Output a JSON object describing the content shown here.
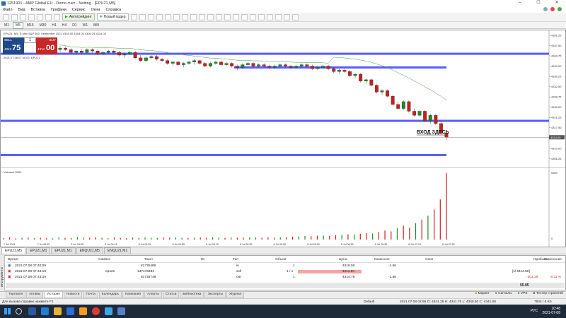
{
  "window": {
    "title": "1251901 - AMP Global EU - Demo счет - Netting - [EPU21,M5]",
    "controls": [
      "–",
      "☐",
      "✕"
    ]
  },
  "menu": [
    "Файл",
    "Вид",
    "Вставка",
    "Графики",
    "Сервис",
    "Окна",
    "Справка"
  ],
  "toolbar": {
    "autotrade": "Автотрейдинг",
    "new_order": "Новый ордер"
  },
  "timeframes": [
    "M1",
    "M5",
    "M15",
    "M30",
    "H1",
    "H4",
    "D1",
    "W1",
    "MN"
  ],
  "active_timeframe": "M5",
  "chart": {
    "header": "EPU21, M5: E-Mini S&P 500: September 2021  4318.00 4318.25 4300.25 4314.00",
    "symbol_info": "2021.07.08 07:40:00, EPU21",
    "sell_label": "SELL",
    "buy_label": "BUY",
    "lot": "1",
    "sell_price_small": "4313",
    "sell_price_big": "75",
    "buy_price_small": "4314",
    "buy_price_big": "00",
    "annotation": "ВХОД ЗДЕСЬ",
    "volume_label": "Volumes 5300",
    "volume_axis_max": "5300",
    "volume_axis_min": "0",
    "current_price_label": "4314.00",
    "price_ticks": [
      "4351.25",
      "4347.50",
      "4343.75",
      "4340.00",
      "4336.25",
      "4332.50",
      "4328.75",
      "4325.00",
      "4321.25",
      "4317.50",
      "4313.75",
      "4310.00",
      "4306.25"
    ],
    "time_ticks": [
      "7 Jul 2021",
      "7 Jul 06:55",
      "8 Jul 04:55",
      "8 Jul 04:15",
      "8 Jul 04:35",
      "8 Jul 04:55",
      "8 Jul 05:15",
      "8 Jul 05:35",
      "8 Jul 05:55",
      "8 Jul 06:15",
      "8 Jul 06:35",
      "8 Jul 06:55",
      "8 Jul 07:15",
      "8 Jul 07:35"
    ],
    "bull_color": "#1f8a1f",
    "bear_color": "#c81e1e",
    "level_color": "#5a5aff"
  },
  "chart_tabs": [
    "EPU21,M5",
    "EPU21,M1",
    "EPU21,M1",
    "ENQU21,M5",
    "ENQU21,M1"
  ],
  "terminal": {
    "columns": [
      "Время",
      "Символ",
      "Тикет",
      "ID",
      "Тип",
      "Объем",
      "Цена",
      "Комиссия",
      "Своп",
      "Прибыль",
      "Изменение"
    ],
    "rows": [
      {
        "time": "2021.07.08 07:40:09",
        "symbol": "",
        "ticket": "81735489",
        "type": "in",
        "volume": "1",
        "price": "4318.50",
        "commission": "-1.56",
        "swap": "",
        "profit": "",
        "change": ""
      },
      {
        "time": "2021.07.08 07:43:19",
        "symbol": "epu21",
        "ticket": "137178483",
        "type": "sell",
        "volume": "1 / 1",
        "price": "4314.50",
        "commission": "",
        "swap": "",
        "profit": "[sl 4314.50]",
        "change": ""
      },
      {
        "time": "2021.07.08 07:43:19",
        "symbol": "",
        "ticket": "81735748",
        "type": "out",
        "volume": "1",
        "price": "4314.75",
        "commission": "-1.56",
        "swap": "",
        "profit": "-201.19",
        "change": "-0.11 %"
      }
    ],
    "balance": "55.95",
    "side_label": "Инструменты"
  },
  "bottom_tabs": [
    "Торговля",
    "Активы",
    "История",
    "Новости",
    "Почта",
    "Календарь",
    "Компания",
    "Алерты",
    "Статьи",
    "Библиотека",
    "Эксперты",
    "Журнал"
  ],
  "active_bottom_tab": "История",
  "bottom_right": [
    "Маркет",
    "Сигналы",
    "VPS",
    "Тестер стратегий"
  ],
  "status": {
    "help": "Для вызова справки нажмите F1",
    "profile": "Default",
    "ohlc": "2021.07.08 02:55  O: 4341.25  H: 4341.75  L: 4340.50  C: 4341.00",
    "traffic": "7824 / 6 Kb"
  },
  "taskbar": {
    "lang": "РУС",
    "time": "10:48",
    "date": "2021-07-08"
  },
  "chart_data": {
    "type": "candlestick",
    "price_axis": [
      4304,
      4352
    ],
    "candles": [
      [
        4346.0,
        4347.5,
        4345.0,
        4346.5
      ],
      [
        4346.5,
        4347.0,
        4345.5,
        4346.0
      ],
      [
        4346.0,
        4346.5,
        4344.5,
        4345.0
      ],
      [
        4345.0,
        4346.0,
        4344.0,
        4345.5
      ],
      [
        4345.5,
        4346.0,
        4344.5,
        4345.0
      ],
      [
        4345.0,
        4346.5,
        4344.5,
        4346.0
      ],
      [
        4346.0,
        4346.5,
        4345.0,
        4345.5
      ],
      [
        4345.5,
        4346.0,
        4344.0,
        4344.5
      ],
      [
        4344.5,
        4345.5,
        4344.0,
        4345.0
      ],
      [
        4345.0,
        4346.0,
        4344.5,
        4345.5
      ],
      [
        4345.5,
        4346.0,
        4344.5,
        4345.0
      ],
      [
        4345.0,
        4345.5,
        4343.5,
        4344.0
      ],
      [
        4344.0,
        4345.0,
        4343.0,
        4344.5
      ],
      [
        4344.5,
        4345.5,
        4344.0,
        4345.0
      ],
      [
        4345.0,
        4345.5,
        4342.5,
        4343.0
      ],
      [
        4343.0,
        4344.0,
        4341.5,
        4342.0
      ],
      [
        4342.0,
        4343.5,
        4341.5,
        4343.0
      ],
      [
        4343.0,
        4344.0,
        4342.5,
        4343.5
      ],
      [
        4343.5,
        4344.0,
        4342.0,
        4342.5
      ],
      [
        4342.5,
        4343.0,
        4341.5,
        4342.0
      ],
      [
        4342.0,
        4342.5,
        4340.5,
        4341.0
      ],
      [
        4341.0,
        4342.0,
        4340.0,
        4341.5
      ],
      [
        4341.5,
        4342.0,
        4340.0,
        4340.5
      ],
      [
        4340.5,
        4341.5,
        4339.5,
        4341.0
      ],
      [
        4341.0,
        4342.0,
        4340.5,
        4341.5
      ],
      [
        4341.5,
        4342.5,
        4340.5,
        4342.0
      ],
      [
        4342.0,
        4342.5,
        4340.5,
        4341.0
      ],
      [
        4341.0,
        4341.5,
        4339.5,
        4340.0
      ],
      [
        4340.0,
        4341.5,
        4339.5,
        4341.0
      ],
      [
        4341.0,
        4342.0,
        4340.5,
        4341.5
      ],
      [
        4341.5,
        4342.0,
        4340.0,
        4340.5
      ],
      [
        4340.5,
        4341.5,
        4340.0,
        4341.0
      ],
      [
        4341.0,
        4341.5,
        4339.5,
        4340.0
      ],
      [
        4340.0,
        4340.5,
        4338.5,
        4339.5
      ],
      [
        4339.5,
        4341.0,
        4339.0,
        4340.5
      ],
      [
        4340.5,
        4341.5,
        4340.0,
        4341.0
      ],
      [
        4341.0,
        4341.5,
        4339.5,
        4340.0
      ],
      [
        4340.0,
        4341.0,
        4339.5,
        4340.5
      ],
      [
        4340.5,
        4341.0,
        4339.5,
        4340.0
      ],
      [
        4340.0,
        4340.5,
        4339.0,
        4339.5
      ],
      [
        4339.5,
        4340.5,
        4339.0,
        4340.0
      ],
      [
        4340.0,
        4341.0,
        4339.5,
        4340.5
      ],
      [
        4340.5,
        4341.0,
        4339.5,
        4340.0
      ],
      [
        4340.0,
        4340.5,
        4339.0,
        4339.5
      ],
      [
        4339.5,
        4340.5,
        4339.0,
        4340.0
      ],
      [
        4340.0,
        4341.0,
        4339.5,
        4340.5
      ],
      [
        4340.5,
        4341.0,
        4339.5,
        4340.0
      ],
      [
        4340.0,
        4340.5,
        4338.5,
        4339.0
      ],
      [
        4339.0,
        4340.0,
        4338.5,
        4339.5
      ],
      [
        4339.5,
        4340.5,
        4339.0,
        4340.0
      ],
      [
        4340.0,
        4340.5,
        4338.5,
        4339.0
      ],
      [
        4339.0,
        4339.5,
        4337.5,
        4338.0
      ],
      [
        4338.0,
        4339.0,
        4337.0,
        4338.5
      ],
      [
        4338.5,
        4339.0,
        4337.5,
        4338.0
      ],
      [
        4338.0,
        4338.5,
        4336.0,
        4336.5
      ],
      [
        4336.5,
        4337.5,
        4335.5,
        4337.0
      ],
      [
        4337.0,
        4337.5,
        4334.0,
        4334.5
      ],
      [
        4334.5,
        4335.5,
        4333.5,
        4335.0
      ],
      [
        4335.0,
        4335.5,
        4332.5,
        4333.0
      ],
      [
        4333.0,
        4333.5,
        4330.0,
        4330.5
      ],
      [
        4330.5,
        4331.5,
        4329.5,
        4331.0
      ],
      [
        4331.0,
        4331.5,
        4328.5,
        4329.0
      ],
      [
        4329.0,
        4329.5,
        4325.5,
        4326.0
      ],
      [
        4326.0,
        4327.0,
        4324.0,
        4324.5
      ],
      [
        4324.5,
        4327.5,
        4324.0,
        4327.0
      ],
      [
        4327.0,
        4327.5,
        4323.0,
        4323.5
      ],
      [
        4323.5,
        4324.5,
        4321.5,
        4322.0
      ],
      [
        4322.0,
        4324.0,
        4321.5,
        4323.5
      ],
      [
        4323.5,
        4324.0,
        4319.5,
        4320.0
      ],
      [
        4320.0,
        4322.5,
        4319.0,
        4322.0
      ],
      [
        4322.0,
        4322.5,
        4318.5,
        4319.0
      ],
      [
        4319.0,
        4320.0,
        4315.0,
        4315.5
      ],
      [
        4315.5,
        4316.5,
        4313.0,
        4314.0
      ]
    ],
    "volumes": [
      120,
      180,
      90,
      140,
      160,
      110,
      150,
      130,
      95,
      170,
      140,
      120,
      200,
      160,
      130,
      190,
      150,
      110,
      170,
      140,
      125,
      160,
      135,
      180,
      145,
      120,
      165,
      150,
      175,
      140,
      130,
      155,
      160,
      145,
      185,
      150,
      130,
      165,
      140,
      150,
      175,
      160,
      145,
      190,
      155,
      170,
      200,
      230,
      250,
      280,
      260,
      300,
      320,
      290,
      350,
      380,
      420,
      400,
      460,
      520,
      480,
      600,
      720,
      650,
      900,
      1100,
      950,
      1300,
      1600,
      1900,
      2400,
      3200,
      5300
    ]
  }
}
